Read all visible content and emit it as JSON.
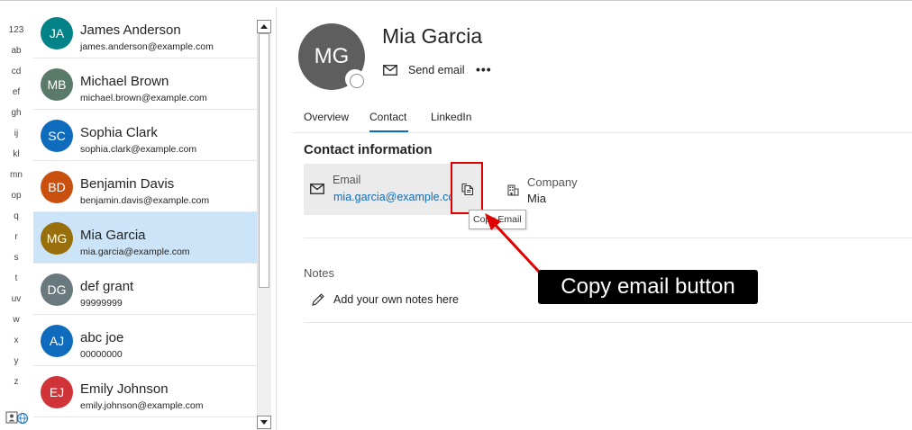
{
  "alpha_index": [
    "123",
    "ab",
    "cd",
    "ef",
    "gh",
    "ij",
    "kl",
    "mn",
    "op",
    "q",
    "r",
    "s",
    "t",
    "uv",
    "w",
    "x",
    "y",
    "z"
  ],
  "contacts": [
    {
      "initials": "JA",
      "name": "James Anderson",
      "email": "james.anderson@example.com",
      "color": "#038387"
    },
    {
      "initials": "MB",
      "name": "Michael Brown",
      "email": "michael.brown@example.com",
      "color": "#5a7a6a"
    },
    {
      "initials": "SC",
      "name": "Sophia Clark",
      "email": "sophia.clark@example.com",
      "color": "#0f6cbd"
    },
    {
      "initials": "BD",
      "name": "Benjamin Davis",
      "email": "benjamin.davis@example.com",
      "color": "#ca5010"
    },
    {
      "initials": "MG",
      "name": "Mia Garcia",
      "email": "mia.garcia@example.com",
      "color": "#986f0b",
      "selected": true
    },
    {
      "initials": "DG",
      "name": "def grant",
      "email": "99999999",
      "color": "#69797e"
    },
    {
      "initials": "AJ",
      "name": "abc joe",
      "email": "00000000",
      "color": "#0f6cbd"
    },
    {
      "initials": "EJ",
      "name": "Emily Johnson",
      "email": "emily.johnson@example.com",
      "color": "#d13438"
    }
  ],
  "detail": {
    "initials": "MG",
    "name": "Mia Garcia",
    "send_email_label": "Send email",
    "more_label": "•••",
    "tabs": [
      {
        "label": "Overview",
        "active": false
      },
      {
        "label": "Contact",
        "active": true
      },
      {
        "label": "LinkedIn",
        "active": false
      }
    ],
    "section_title": "Contact information",
    "email_label": "Email",
    "email_value": "mia.garcia@example.com",
    "company_label": "Company",
    "company_value": "Mia",
    "tooltip": "Copy Email",
    "notes_title": "Notes",
    "notes_placeholder": "Add your own notes here"
  },
  "annotation": {
    "text": "Copy email button",
    "color": "#e00000"
  },
  "icons": {
    "send_email": "mail-icon",
    "copy": "copy-icon",
    "company": "building-icon",
    "notes": "pencil-icon",
    "bottom": "contact-globe-icon"
  }
}
